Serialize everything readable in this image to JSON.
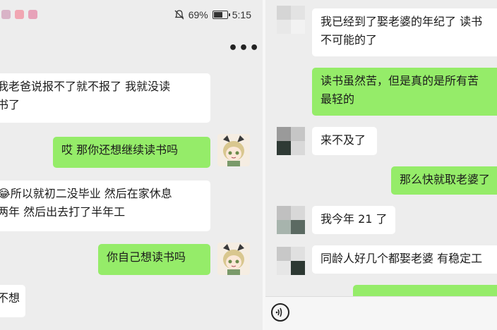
{
  "left": {
    "status": {
      "battery": "69%",
      "time": "5:15"
    },
    "messages": [
      {
        "side": "in",
        "lines": [
          "我老爸说报不了就不报了 我就没读",
          "书了"
        ]
      },
      {
        "side": "out",
        "lines": [
          "哎 那你还想继续读书吗"
        ]
      },
      {
        "side": "in",
        "lines": [
          "😂所以就初二没毕业 然后在家休息",
          "两年 然后出去打了半年工"
        ]
      },
      {
        "side": "out",
        "lines": [
          "你自己想读书吗"
        ]
      },
      {
        "side": "in",
        "lines": [
          "不想"
        ]
      }
    ]
  },
  "right": {
    "messages": [
      {
        "side": "in",
        "lines": [
          "我已经到了娶老婆的年纪了 读书",
          "不可能的了"
        ]
      },
      {
        "side": "out",
        "lines": [
          "读书虽然苦，但是真的是所有苦",
          "最轻的"
        ]
      },
      {
        "side": "in",
        "lines": [
          "来不及了"
        ]
      },
      {
        "side": "out",
        "lines": [
          "那么快就取老婆了"
        ]
      },
      {
        "side": "in",
        "lines": [
          "我今年 21 了"
        ]
      },
      {
        "side": "in",
        "lines": [
          "同龄人好几个都娶老婆 有稳定工"
        ]
      }
    ]
  },
  "colors": {
    "outgoing_bubble": "#95ec69",
    "incoming_bubble": "#ffffff",
    "background": "#ededed"
  },
  "icons": {
    "more": "more-dots-icon",
    "voice": "voice-input-icon",
    "mute": "bell-muted-icon",
    "battery": "battery-icon"
  }
}
